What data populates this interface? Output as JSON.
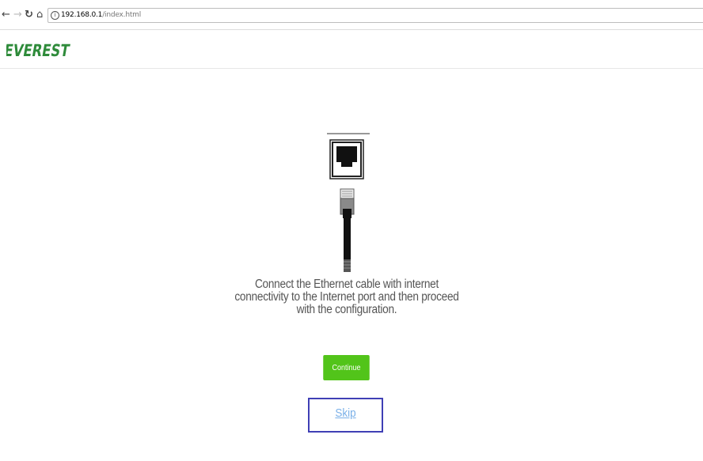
{
  "browser": {
    "url_host": "192.168.0.1",
    "url_path": "/index.html",
    "info_glyph": "i"
  },
  "header": {
    "logo_text": "EVEREST"
  },
  "main": {
    "message": "Connect the Ethernet cable with internet connectivity to the Internet port and then proceed with the configuration.",
    "continue_label": "Continue",
    "skip_label": "Skip"
  },
  "colors": {
    "accent_green": "#52c41a",
    "link_blue": "#7ab0e8",
    "highlight_box": "#3f3fb5",
    "logo_green": "#2e8b3a"
  },
  "icons": [
    "back-arrow-icon",
    "forward-arrow-icon",
    "reload-icon",
    "home-icon",
    "info-icon",
    "ethernet-port-icon",
    "ethernet-cable-icon"
  ]
}
